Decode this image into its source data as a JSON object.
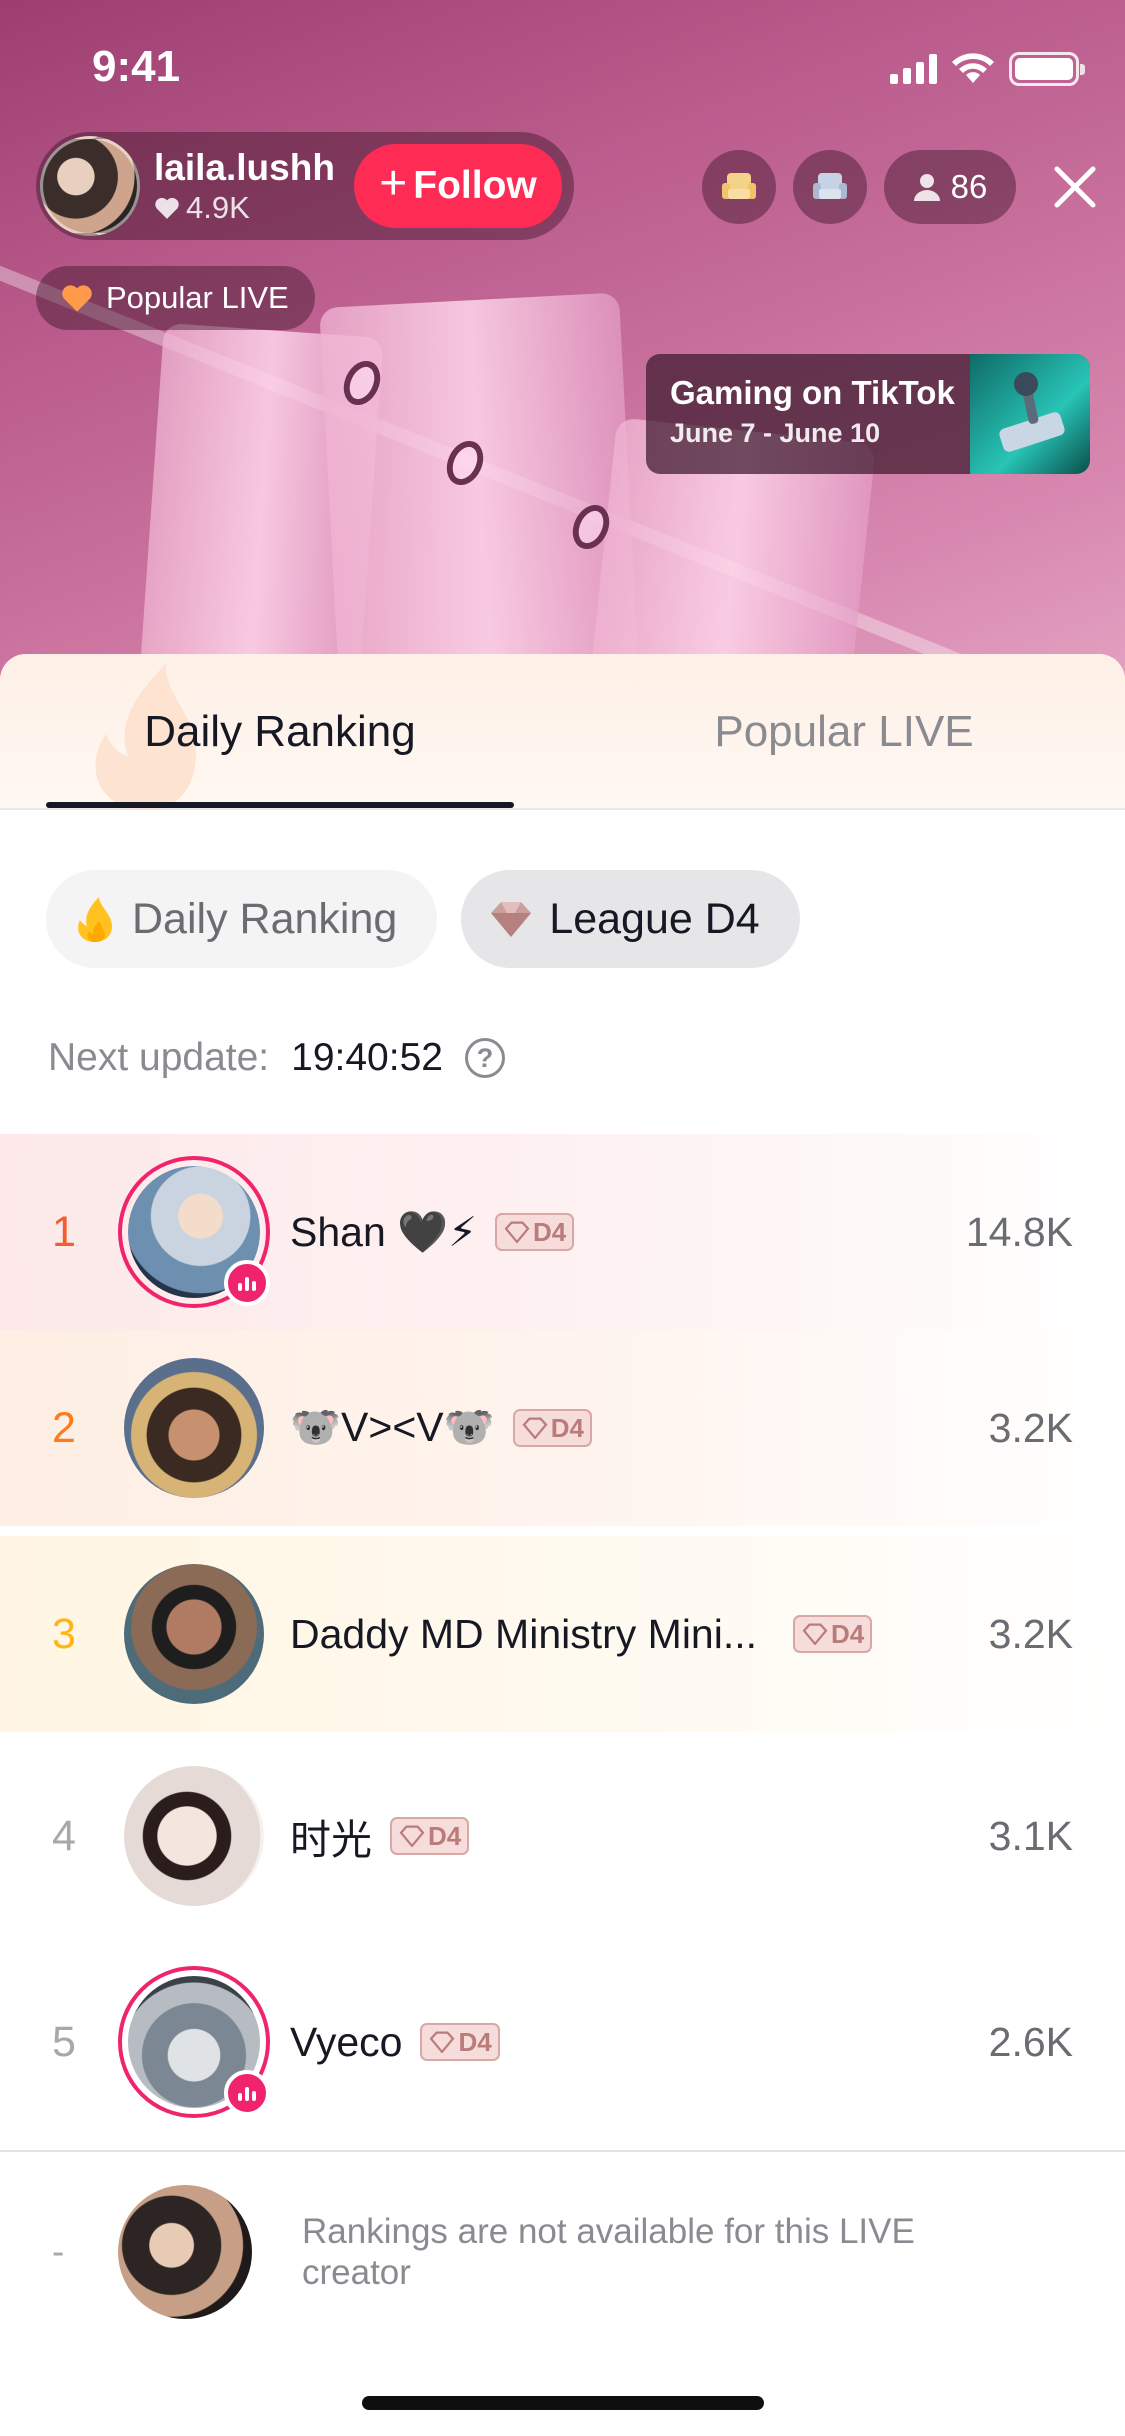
{
  "status_bar": {
    "time": "9:41"
  },
  "live_header": {
    "host_name": "laila.lushh",
    "host_likes": "4.9K",
    "follow_label": "Follow",
    "viewer_count": "86",
    "popular_live_chip": "Popular LIVE"
  },
  "promo": {
    "title": "Gaming on TikTok",
    "dates": "June 7 - June 10"
  },
  "tabs": [
    {
      "label": "Daily Ranking",
      "active": true
    },
    {
      "label": "Popular LIVE",
      "active": false
    }
  ],
  "chips": {
    "daily_label": "Daily Ranking",
    "league_label": "League D4"
  },
  "next_update": {
    "label": "Next update:",
    "time": "19:40:52"
  },
  "rankings": [
    {
      "rank": "1",
      "name": "Shan 🖤⚡",
      "league": "D4",
      "score": "14.8K",
      "is_live": true
    },
    {
      "rank": "2",
      "name": "🐨V><V🐨",
      "league": "D4",
      "score": "3.2K",
      "is_live": false
    },
    {
      "rank": "3",
      "name": "Daddy MD Ministry Mini...",
      "league": "D4",
      "score": "3.2K",
      "is_live": false
    },
    {
      "rank": "4",
      "name": "时光",
      "league": "D4",
      "score": "3.1K",
      "is_live": false
    },
    {
      "rank": "5",
      "name": "Vyeco",
      "league": "D4",
      "score": "2.6K",
      "is_live": true
    }
  ],
  "self_row": {
    "rank": "-",
    "note": "Rankings are not available for this LIVE creator"
  },
  "colors": {
    "accent": "#fe2c55",
    "live_ring": "#f0246d",
    "rank1": "#f35e2c",
    "rank2": "#ff7a1a",
    "rank3": "#ffb516"
  }
}
